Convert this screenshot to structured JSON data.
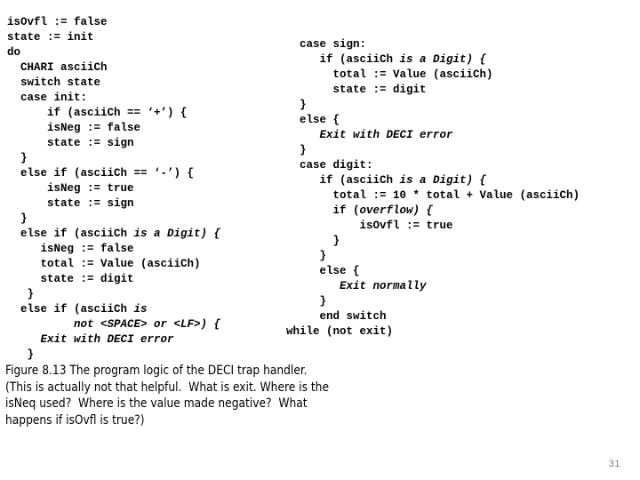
{
  "slide": {
    "background_color": "#ffffff",
    "text_color": "#000000",
    "page_number": "31"
  },
  "code_left": {
    "lines": [
      {
        "text": "isOvfl := false",
        "indent": 0
      },
      {
        "text": "state := init",
        "indent": 0
      },
      {
        "text": "do",
        "indent": 0
      },
      {
        "text": "  CHARI asciiCh",
        "indent": 0
      },
      {
        "text": "  switch state",
        "indent": 0
      },
      {
        "text": "  case init:",
        "indent": 0
      },
      {
        "text": "      if (asciiCh == ‘+’) {",
        "indent": 0
      },
      {
        "text": "      isNeg := false",
        "indent": 0
      },
      {
        "text": "      state := sign",
        "indent": 0
      },
      {
        "text": "  }",
        "indent": 0
      },
      {
        "text": "  else if (asciiCh == ‘-’) {",
        "indent": 0
      },
      {
        "text": "      isNeg := true",
        "indent": 0
      },
      {
        "text": "      state := sign",
        "indent": 0
      },
      {
        "text": "  }",
        "indent": 0
      },
      {
        "text": "  else if (asciiCh ",
        "italic": "is a Digit) {",
        "indent": 0
      },
      {
        "text": "     isNeg := false",
        "indent": 0
      },
      {
        "text": "     total := Value (asciiCh)",
        "indent": 0
      },
      {
        "text": "     state := digit",
        "indent": 0
      },
      {
        "text": "   }",
        "indent": 0
      },
      {
        "text": "  else if (asciiCh ",
        "italic": "is",
        "indent": 0
      },
      {
        "text": "          ",
        "italic": "not <SPACE> or <LF>) {",
        "indent": 0
      },
      {
        "text": "     ",
        "italic": "Exit with DECI error",
        "indent": 0
      },
      {
        "text": "   }",
        "indent": 0
      }
    ]
  },
  "code_right": {
    "lines": [
      {
        "text": "  case sign:",
        "indent": 0
      },
      {
        "text": "     if (asciiCh ",
        "italic": "is a Digit) {",
        "indent": 0
      },
      {
        "text": "       total := Value (asciiCh)",
        "indent": 0
      },
      {
        "text": "       state := digit",
        "indent": 0
      },
      {
        "text": "  }",
        "indent": 0
      },
      {
        "text": "  else {",
        "indent": 0
      },
      {
        "text": "     ",
        "italic": "Exit with DECI error",
        "indent": 0
      },
      {
        "text": "  }",
        "indent": 0
      },
      {
        "text": "  case digit:",
        "indent": 0
      },
      {
        "text": "     if (asciiCh ",
        "italic": "is a Digit) {",
        "indent": 0
      },
      {
        "text": "       total := 10 * total + Value (asciiCh)",
        "indent": 0
      },
      {
        "text": "       if (",
        "italic": "overflow) {",
        "indent": 0
      },
      {
        "text": "           isOvfl := true",
        "indent": 0
      },
      {
        "text": "       }",
        "indent": 0
      },
      {
        "text": "     }",
        "indent": 0
      },
      {
        "text": "     else {",
        "indent": 0
      },
      {
        "text": "        ",
        "italic": "Exit normally",
        "indent": 0
      },
      {
        "text": "     }",
        "indent": 0
      },
      {
        "text": "     end switch",
        "indent": 0
      },
      {
        "text": "while (not exit)",
        "indent": 0
      }
    ]
  },
  "caption": {
    "lines": [
      "Figure 8.13 The program logic of the DECI trap handler.",
      "(This is actually not that helpful.  What is exit. Where is the",
      "isNeq used?  Where is the value made negative?  What",
      "happens if isOvfl is true?)"
    ]
  }
}
